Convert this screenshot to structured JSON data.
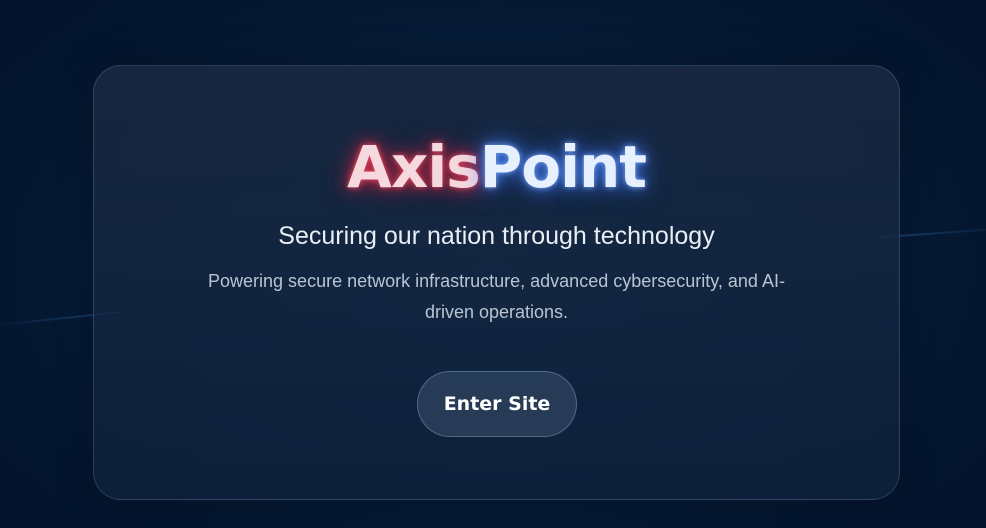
{
  "brand": {
    "name_part_1": "Axis",
    "name_part_2": "Point",
    "glow_color_1": "#e0304f",
    "glow_color_2": "#4a82ff"
  },
  "hero": {
    "tagline": "Securing our nation through technology",
    "description": "Powering secure network infrastructure, advanced cybersecurity, and AI-driven operations.",
    "cta_label": "Enter Site"
  },
  "colors": {
    "background": "#071d38",
    "card": "#1a2a44",
    "button": "#2c3f58"
  }
}
